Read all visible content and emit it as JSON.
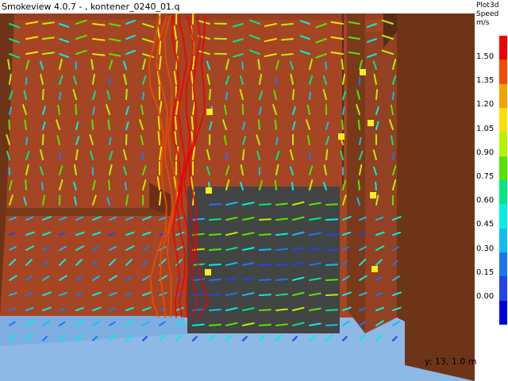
{
  "window": {
    "title": "Smokeview 4.0.7 - , kontener_0240_01.q"
  },
  "colorbar": {
    "title_lines": [
      "Plot3d",
      "Speed",
      "m/s"
    ],
    "labels": [
      "1.50",
      "1.35",
      "1.20",
      "1.05",
      "0.90",
      "0.75",
      "0.60",
      "0.45",
      "0.30",
      "0.15",
      "0.00"
    ],
    "colors": [
      "#f00000",
      "#f34a00",
      "#f7a200",
      "#f9e000",
      "#b6f200",
      "#53e600",
      "#00e87f",
      "#00f0e4",
      "#12bdf4",
      "#1a76f0",
      "#2244e8",
      "#0000dd"
    ]
  },
  "slice_readout": "y: 13, 1.0 m",
  "scene": {
    "wall_color": "#a54524",
    "floor_color": "#8eb8e6",
    "pillar_color": "#6e3418",
    "obstacle_color": "#434444",
    "marker_color": "#f7ee1f"
  }
}
